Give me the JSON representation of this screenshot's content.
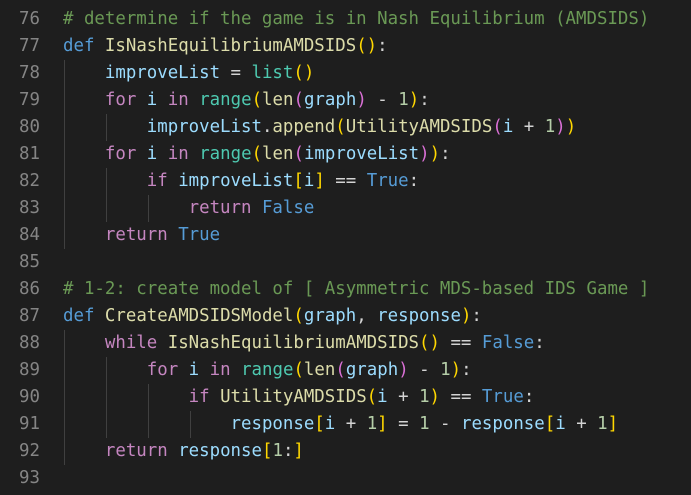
{
  "editor": {
    "theme_colors": {
      "background": "#1e1e1e",
      "line_number": "#858585",
      "comment": "#6a9955",
      "keyword": "#569cd6",
      "control": "#c586c0",
      "function": "#dcdcaa",
      "variable": "#9cdcfe",
      "number": "#b5cea8",
      "bracket_1": "#ffd700",
      "bracket_2": "#da70d6",
      "bracket_3": "#179fff",
      "plain": "#d4d4d4"
    },
    "lines": [
      {
        "num": "76",
        "indent": 0,
        "tokens": [
          {
            "t": "# determine if the game is in Nash Equilibrium (AMDSIDS)",
            "c": "comment"
          }
        ]
      },
      {
        "num": "77",
        "indent": 0,
        "tokens": [
          {
            "t": "def",
            "c": "kw"
          },
          {
            "t": " ",
            "c": "plain"
          },
          {
            "t": "IsNashEquilibriumAMDSIDS",
            "c": "func"
          },
          {
            "t": "(",
            "c": "p1"
          },
          {
            "t": ")",
            "c": "p1"
          },
          {
            "t": ":",
            "c": "plain"
          }
        ]
      },
      {
        "num": "78",
        "indent": 1,
        "tokens": [
          {
            "t": "    ",
            "c": "plain"
          },
          {
            "t": "improveList",
            "c": "var"
          },
          {
            "t": " = ",
            "c": "plain"
          },
          {
            "t": "list",
            "c": "class"
          },
          {
            "t": "(",
            "c": "p1"
          },
          {
            "t": ")",
            "c": "p1"
          }
        ]
      },
      {
        "num": "79",
        "indent": 1,
        "tokens": [
          {
            "t": "    ",
            "c": "plain"
          },
          {
            "t": "for",
            "c": "ctrl"
          },
          {
            "t": " ",
            "c": "plain"
          },
          {
            "t": "i",
            "c": "var"
          },
          {
            "t": " ",
            "c": "plain"
          },
          {
            "t": "in",
            "c": "ctrl"
          },
          {
            "t": " ",
            "c": "plain"
          },
          {
            "t": "range",
            "c": "class"
          },
          {
            "t": "(",
            "c": "p1"
          },
          {
            "t": "len",
            "c": "func"
          },
          {
            "t": "(",
            "c": "p2"
          },
          {
            "t": "graph",
            "c": "var"
          },
          {
            "t": ")",
            "c": "p2"
          },
          {
            "t": " - ",
            "c": "plain"
          },
          {
            "t": "1",
            "c": "num"
          },
          {
            "t": ")",
            "c": "p1"
          },
          {
            "t": ":",
            "c": "plain"
          }
        ]
      },
      {
        "num": "80",
        "indent": 2,
        "tokens": [
          {
            "t": "        ",
            "c": "plain"
          },
          {
            "t": "improveList",
            "c": "var"
          },
          {
            "t": ".",
            "c": "plain"
          },
          {
            "t": "append",
            "c": "func"
          },
          {
            "t": "(",
            "c": "p1"
          },
          {
            "t": "UtilityAMDSIDS",
            "c": "func"
          },
          {
            "t": "(",
            "c": "p2"
          },
          {
            "t": "i",
            "c": "var"
          },
          {
            "t": " + ",
            "c": "plain"
          },
          {
            "t": "1",
            "c": "num"
          },
          {
            "t": ")",
            "c": "p2"
          },
          {
            "t": ")",
            "c": "p1"
          }
        ]
      },
      {
        "num": "81",
        "indent": 1,
        "tokens": [
          {
            "t": "    ",
            "c": "plain"
          },
          {
            "t": "for",
            "c": "ctrl"
          },
          {
            "t": " ",
            "c": "plain"
          },
          {
            "t": "i",
            "c": "var"
          },
          {
            "t": " ",
            "c": "plain"
          },
          {
            "t": "in",
            "c": "ctrl"
          },
          {
            "t": " ",
            "c": "plain"
          },
          {
            "t": "range",
            "c": "class"
          },
          {
            "t": "(",
            "c": "p1"
          },
          {
            "t": "len",
            "c": "func"
          },
          {
            "t": "(",
            "c": "p2"
          },
          {
            "t": "improveList",
            "c": "var"
          },
          {
            "t": ")",
            "c": "p2"
          },
          {
            "t": ")",
            "c": "p1"
          },
          {
            "t": ":",
            "c": "plain"
          }
        ]
      },
      {
        "num": "82",
        "indent": 2,
        "tokens": [
          {
            "t": "        ",
            "c": "plain"
          },
          {
            "t": "if",
            "c": "ctrl"
          },
          {
            "t": " ",
            "c": "plain"
          },
          {
            "t": "improveList",
            "c": "var"
          },
          {
            "t": "[",
            "c": "p1"
          },
          {
            "t": "i",
            "c": "var"
          },
          {
            "t": "]",
            "c": "p1"
          },
          {
            "t": " == ",
            "c": "plain"
          },
          {
            "t": "True",
            "c": "const"
          },
          {
            "t": ":",
            "c": "plain"
          }
        ]
      },
      {
        "num": "83",
        "indent": 3,
        "tokens": [
          {
            "t": "            ",
            "c": "plain"
          },
          {
            "t": "return",
            "c": "ctrl"
          },
          {
            "t": " ",
            "c": "plain"
          },
          {
            "t": "False",
            "c": "const"
          }
        ]
      },
      {
        "num": "84",
        "indent": 1,
        "tokens": [
          {
            "t": "    ",
            "c": "plain"
          },
          {
            "t": "return",
            "c": "ctrl"
          },
          {
            "t": " ",
            "c": "plain"
          },
          {
            "t": "True",
            "c": "const"
          }
        ]
      },
      {
        "num": "85",
        "indent": 0,
        "tokens": []
      },
      {
        "num": "86",
        "indent": 0,
        "tokens": [
          {
            "t": "# 1-2: create model of [ Asymmetric MDS-based IDS Game ]",
            "c": "comment"
          }
        ]
      },
      {
        "num": "87",
        "indent": 0,
        "tokens": [
          {
            "t": "def",
            "c": "kw"
          },
          {
            "t": " ",
            "c": "plain"
          },
          {
            "t": "CreateAMDSIDSModel",
            "c": "func"
          },
          {
            "t": "(",
            "c": "p1"
          },
          {
            "t": "graph",
            "c": "var"
          },
          {
            "t": ", ",
            "c": "plain"
          },
          {
            "t": "response",
            "c": "var"
          },
          {
            "t": ")",
            "c": "p1"
          },
          {
            "t": ":",
            "c": "plain"
          }
        ]
      },
      {
        "num": "88",
        "indent": 1,
        "tokens": [
          {
            "t": "    ",
            "c": "plain"
          },
          {
            "t": "while",
            "c": "ctrl"
          },
          {
            "t": " ",
            "c": "plain"
          },
          {
            "t": "IsNashEquilibriumAMDSIDS",
            "c": "func"
          },
          {
            "t": "(",
            "c": "p1"
          },
          {
            "t": ")",
            "c": "p1"
          },
          {
            "t": " == ",
            "c": "plain"
          },
          {
            "t": "False",
            "c": "const"
          },
          {
            "t": ":",
            "c": "plain"
          }
        ]
      },
      {
        "num": "89",
        "indent": 2,
        "tokens": [
          {
            "t": "        ",
            "c": "plain"
          },
          {
            "t": "for",
            "c": "ctrl"
          },
          {
            "t": " ",
            "c": "plain"
          },
          {
            "t": "i",
            "c": "var"
          },
          {
            "t": " ",
            "c": "plain"
          },
          {
            "t": "in",
            "c": "ctrl"
          },
          {
            "t": " ",
            "c": "plain"
          },
          {
            "t": "range",
            "c": "class"
          },
          {
            "t": "(",
            "c": "p1"
          },
          {
            "t": "len",
            "c": "func"
          },
          {
            "t": "(",
            "c": "p2"
          },
          {
            "t": "graph",
            "c": "var"
          },
          {
            "t": ")",
            "c": "p2"
          },
          {
            "t": " - ",
            "c": "plain"
          },
          {
            "t": "1",
            "c": "num"
          },
          {
            "t": ")",
            "c": "p1"
          },
          {
            "t": ":",
            "c": "plain"
          }
        ]
      },
      {
        "num": "90",
        "indent": 3,
        "tokens": [
          {
            "t": "            ",
            "c": "plain"
          },
          {
            "t": "if",
            "c": "ctrl"
          },
          {
            "t": " ",
            "c": "plain"
          },
          {
            "t": "UtilityAMDSIDS",
            "c": "func"
          },
          {
            "t": "(",
            "c": "p1"
          },
          {
            "t": "i",
            "c": "var"
          },
          {
            "t": " + ",
            "c": "plain"
          },
          {
            "t": "1",
            "c": "num"
          },
          {
            "t": ")",
            "c": "p1"
          },
          {
            "t": " == ",
            "c": "plain"
          },
          {
            "t": "True",
            "c": "const"
          },
          {
            "t": ":",
            "c": "plain"
          }
        ]
      },
      {
        "num": "91",
        "indent": 4,
        "tokens": [
          {
            "t": "                ",
            "c": "plain"
          },
          {
            "t": "response",
            "c": "var"
          },
          {
            "t": "[",
            "c": "p1"
          },
          {
            "t": "i",
            "c": "var"
          },
          {
            "t": " + ",
            "c": "plain"
          },
          {
            "t": "1",
            "c": "num"
          },
          {
            "t": "]",
            "c": "p1"
          },
          {
            "t": " = ",
            "c": "plain"
          },
          {
            "t": "1",
            "c": "num"
          },
          {
            "t": " - ",
            "c": "plain"
          },
          {
            "t": "response",
            "c": "var"
          },
          {
            "t": "[",
            "c": "p1"
          },
          {
            "t": "i",
            "c": "var"
          },
          {
            "t": " + ",
            "c": "plain"
          },
          {
            "t": "1",
            "c": "num"
          },
          {
            "t": "]",
            "c": "p1"
          }
        ]
      },
      {
        "num": "92",
        "indent": 1,
        "tokens": [
          {
            "t": "    ",
            "c": "plain"
          },
          {
            "t": "return",
            "c": "ctrl"
          },
          {
            "t": " ",
            "c": "plain"
          },
          {
            "t": "response",
            "c": "var"
          },
          {
            "t": "[",
            "c": "p1"
          },
          {
            "t": "1",
            "c": "num"
          },
          {
            "t": ":",
            "c": "plain"
          },
          {
            "t": "]",
            "c": "p1"
          }
        ]
      },
      {
        "num": "93",
        "indent": 0,
        "tokens": []
      }
    ]
  }
}
